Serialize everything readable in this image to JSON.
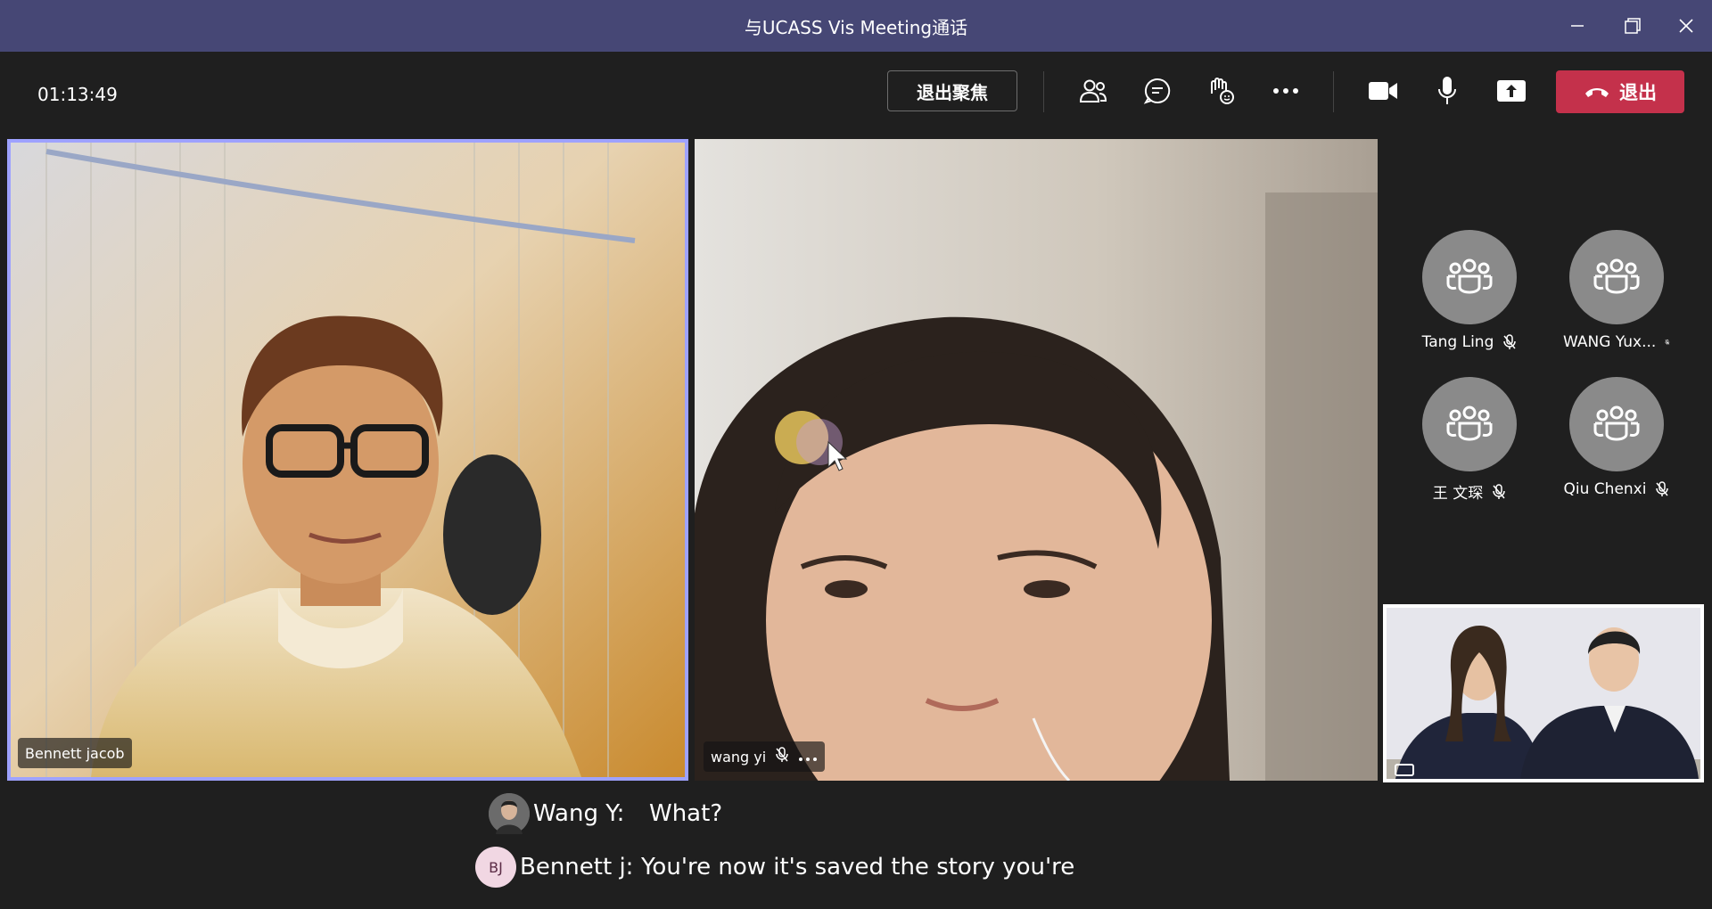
{
  "window": {
    "title": "与UCASS Vis Meeting通话",
    "minimize_icon": "minimize-icon",
    "maximize_icon": "restore-icon",
    "close_icon": "close-icon"
  },
  "toolbar": {
    "timer": "01:13:49",
    "exit_focus_label": "退出聚焦",
    "leave_label": "退出",
    "icons": [
      "participants-icon",
      "chat-icon",
      "reactions-icon",
      "more-icon",
      "camera-icon",
      "microphone-icon",
      "share-screen-icon",
      "phone-hangup-icon"
    ]
  },
  "tiles": [
    {
      "name": "Bennett jacob",
      "muted": false
    },
    {
      "name": "wang yi",
      "muted": true
    }
  ],
  "participants": [
    {
      "name": "Tang Ling",
      "muted": true
    },
    {
      "name": "WANG Yux...",
      "muted": true
    },
    {
      "name": "王 文琛",
      "muted": true
    },
    {
      "name": "Qiu Chenxi",
      "muted": true
    }
  ],
  "captions": [
    {
      "speaker": "Wang Y:",
      "text": "What?",
      "initials": ""
    },
    {
      "speaker": "Bennett j:",
      "text": "You're now it's saved the story you're",
      "initials": "BJ"
    }
  ],
  "colors": {
    "titlebar": "#464775",
    "background": "#1f1f1f",
    "leave": "#c4314b",
    "active_border": "#9ea2ff"
  }
}
